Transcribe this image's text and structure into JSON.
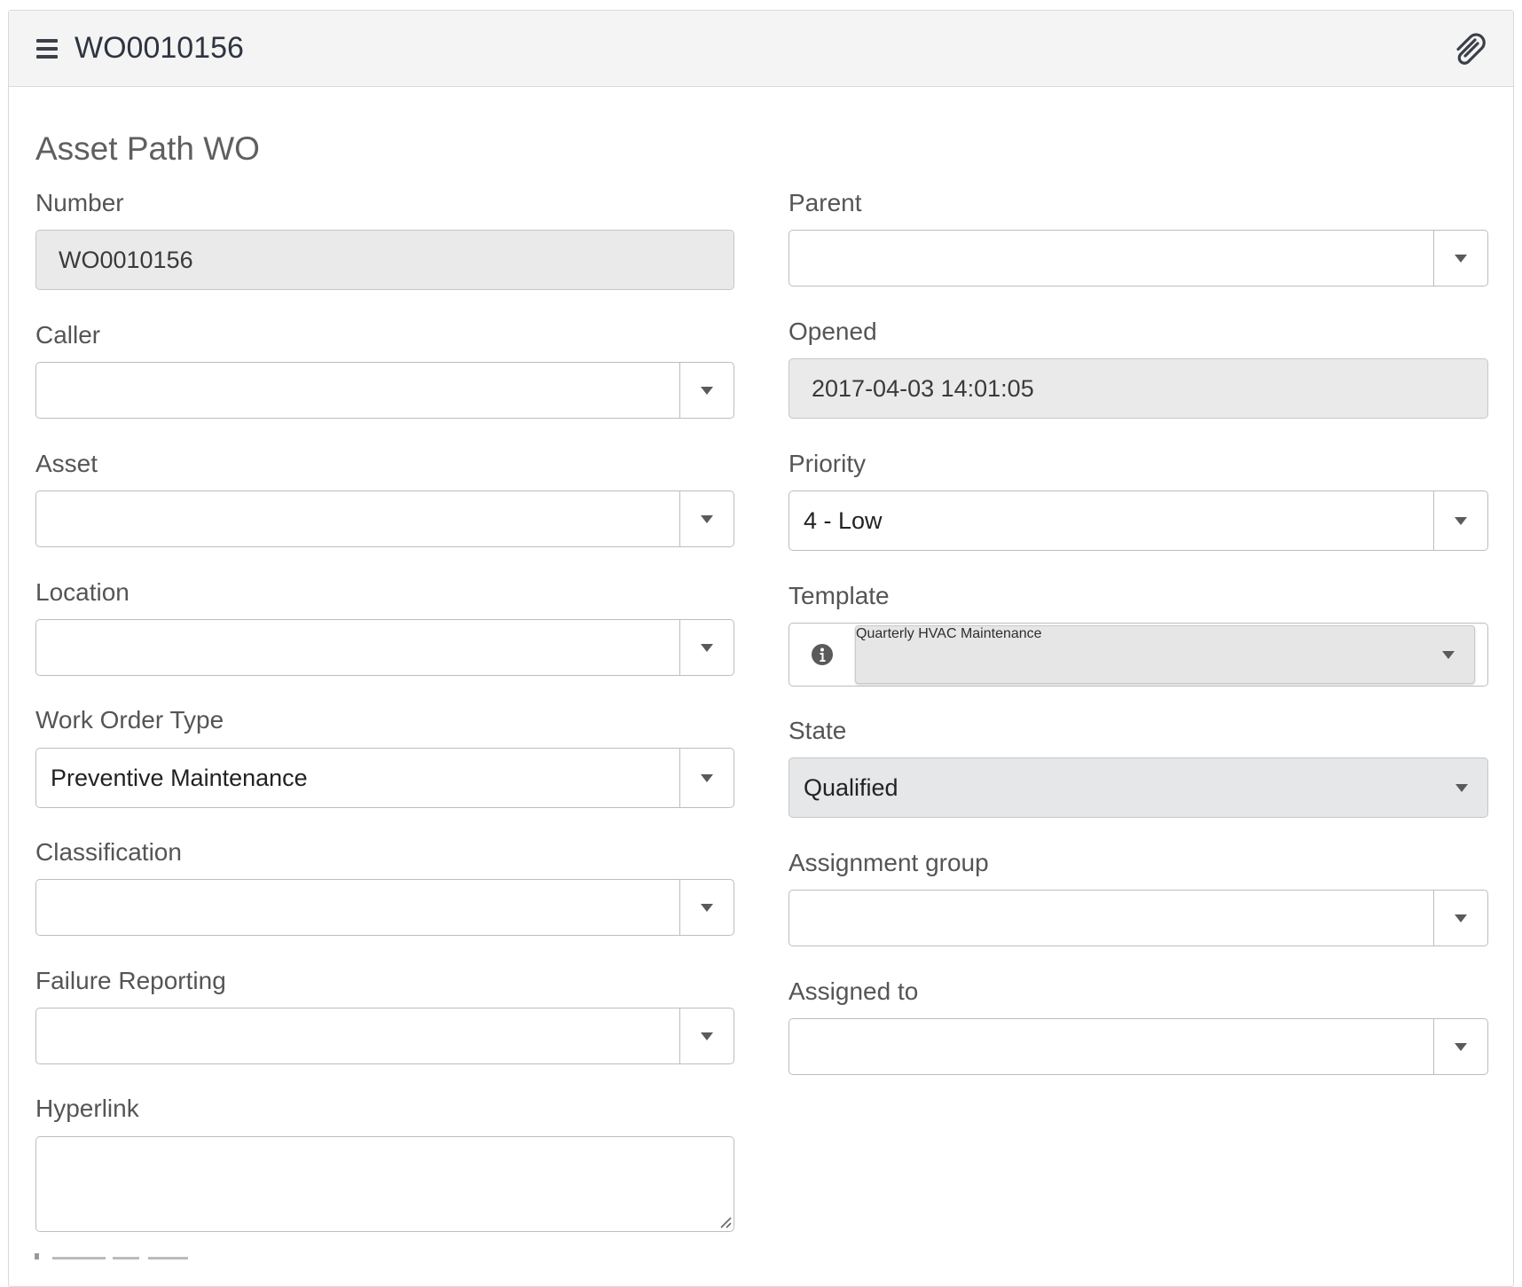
{
  "header": {
    "title": "WO0010156",
    "menu_icon": "hamburger-menu-icon",
    "attachment_icon": "paperclip-icon"
  },
  "form": {
    "title": "Asset Path WO",
    "left": {
      "number": {
        "label": "Number",
        "value": "WO0010156"
      },
      "caller": {
        "label": "Caller",
        "value": ""
      },
      "asset": {
        "label": "Asset",
        "value": ""
      },
      "location": {
        "label": "Location",
        "value": ""
      },
      "work_order_type": {
        "label": "Work Order Type",
        "value": "Preventive Maintenance"
      },
      "classification": {
        "label": "Classification",
        "value": ""
      },
      "failure_reporting": {
        "label": "Failure Reporting",
        "value": ""
      },
      "hyperlink": {
        "label": "Hyperlink",
        "value": ""
      }
    },
    "right": {
      "parent": {
        "label": "Parent",
        "value": ""
      },
      "opened": {
        "label": "Opened",
        "value": "2017-04-03 14:01:05"
      },
      "priority": {
        "label": "Priority",
        "value": "4 - Low"
      },
      "template": {
        "label": "Template",
        "value": "Quarterly HVAC Maintenance",
        "icon": "info-icon"
      },
      "state": {
        "label": "State",
        "value": "Qualified"
      },
      "assignment_group": {
        "label": "Assignment group",
        "value": ""
      },
      "assigned_to": {
        "label": "Assigned to",
        "value": ""
      }
    }
  },
  "colors": {
    "header_bg": "#f4f4f4",
    "readonly_bg": "#eaeaea",
    "border": "#bdbdbd",
    "label_text": "#555555",
    "title_text": "#2e3440"
  }
}
